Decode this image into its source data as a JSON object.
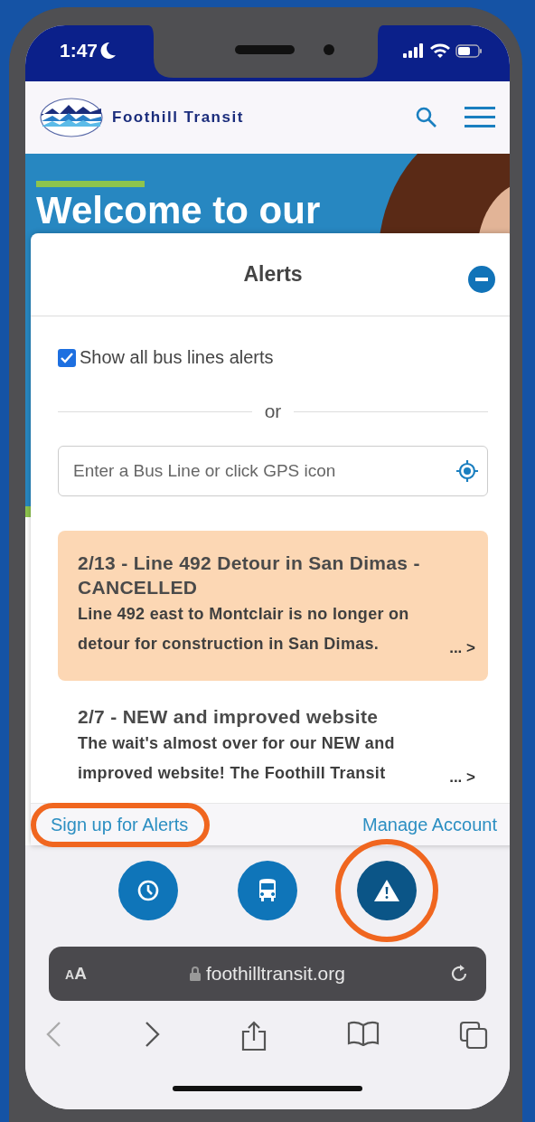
{
  "status_bar": {
    "time": "1:47"
  },
  "header": {
    "brand": "Foothill Transit"
  },
  "hero": {
    "heading": "Welcome to our"
  },
  "alerts_panel": {
    "title": "Alerts",
    "show_all": {
      "label": "Show all bus lines alerts",
      "checked": true
    },
    "separator": "or",
    "search": {
      "placeholder": "Enter a Bus Line or click GPS icon"
    },
    "alerts": [
      {
        "title": "2/13 - Line 492 Detour in San Dimas - CANCELLED",
        "body": "Line 492 east to Montclair is no longer on detour for construction in San Dimas.",
        "more": "... >",
        "highlighted": true
      },
      {
        "title": "2/7 - NEW and improved website",
        "body": "The wait's almost over for our NEW and improved website! The Foothill Transit",
        "more": "... >",
        "highlighted": false
      }
    ],
    "links": [
      {
        "label": "Sign up for Alerts",
        "circled": true
      },
      {
        "label": "Manage Account",
        "circled": false
      }
    ]
  },
  "nav": [
    {
      "kind": "clock",
      "selected": false,
      "circled": false
    },
    {
      "kind": "bus",
      "selected": false,
      "circled": false
    },
    {
      "kind": "alert",
      "selected": true,
      "circled": true
    }
  ],
  "browser": {
    "text_size": "AA",
    "url": "foothilltransit.org"
  }
}
